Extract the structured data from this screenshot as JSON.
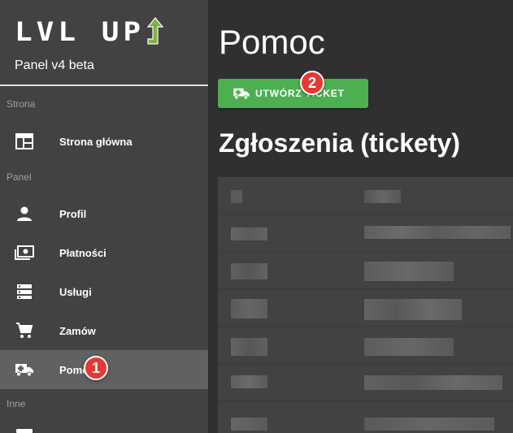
{
  "brand": {
    "logo_text": "LVL UP",
    "subtitle": "Panel v4 beta",
    "arrow_color": "#7cb342"
  },
  "sidebar": {
    "sections": [
      {
        "label": "Strona",
        "items": [
          {
            "label": "Strona główna",
            "icon": "dashboard-icon",
            "active": false
          }
        ]
      },
      {
        "label": "Panel",
        "items": [
          {
            "label": "Profil",
            "icon": "person-icon",
            "active": false
          },
          {
            "label": "Płatności",
            "icon": "money-icon",
            "active": false
          },
          {
            "label": "Usługi",
            "icon": "servers-icon",
            "active": false
          },
          {
            "label": "Zamów",
            "icon": "cart-icon",
            "active": false
          },
          {
            "label": "Pomoc",
            "icon": "ambulance-icon",
            "active": true
          }
        ]
      },
      {
        "label": "Inne",
        "items": []
      }
    ]
  },
  "main": {
    "title": "Pomoc",
    "create_button": {
      "label": "UTWÓRZ TICKET",
      "icon": "ambulance-icon",
      "color": "#4caf50"
    },
    "section_title": "Zgłoszenia (tickety)"
  },
  "annotations": [
    "1",
    "2"
  ]
}
